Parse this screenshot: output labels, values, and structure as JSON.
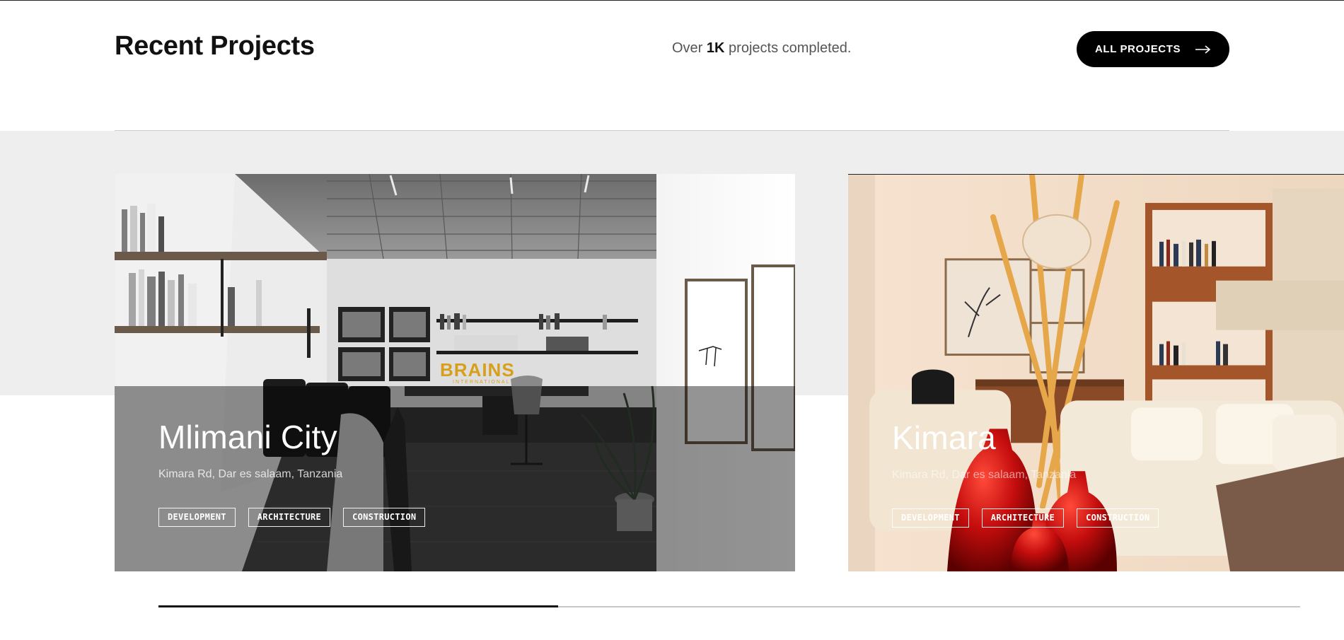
{
  "header": {
    "title": "Recent Projects",
    "stat_prefix": "Over ",
    "stat_bold": "1K",
    "stat_suffix": " projects completed.",
    "all_projects_label": "ALL PROJECTS",
    "arrow_icon": "arrow-right-icon"
  },
  "projects": [
    {
      "title": "Mlimani City",
      "location": "Kimara Rd, Dar es salaam, Tanzania",
      "logo_text": "BRAINS",
      "logo_subtext": "INTERNATIONAL",
      "tags": [
        "DEVELOPMENT",
        "ARCHITECTURE",
        "CONSTRUCTION"
      ]
    },
    {
      "title": "Kimara",
      "location": "Kimara Rd, Dar es salaam, Tanzania",
      "tags": [
        "DEVELOPMENT",
        "ARCHITECTURE",
        "CONSTRUCTION"
      ]
    }
  ],
  "slider": {
    "progress": 0.35
  },
  "colors": {
    "accent": "#000000",
    "band": "#eeeeee",
    "divider": "#cfcfcf",
    "vase_red": "#c40d0d"
  }
}
